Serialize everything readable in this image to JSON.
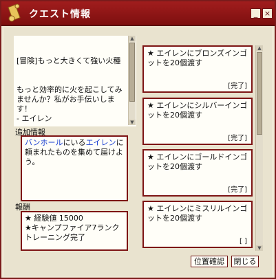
{
  "window": {
    "title": "クエスト情報",
    "minimize_glyph": "_",
    "close_glyph": "×"
  },
  "quest": {
    "title_text": "[冒険]もっと大きくて強い火種",
    "description": "もっと効率的に火を起こしてみませんか？私がお手伝いします！\n- エイレン"
  },
  "additional_info": {
    "label": "追加情報",
    "seg1": "バンホール",
    "seg2": "にいる",
    "seg3": "エイレン",
    "seg4": "に頼まれたものを集めて届けよう。"
  },
  "reward": {
    "label": "報酬",
    "line1": "★ 経験値 15000",
    "line2": "★キャンプファイア7ランクトレーニング完了"
  },
  "objectives": [
    {
      "text": "★ エイレンにブロンズインゴットを20個渡す",
      "status": "[完了]"
    },
    {
      "text": "★ エイレンにシルバーインゴットを20個渡す",
      "status": "[完了]"
    },
    {
      "text": "★ エイレンにゴールドインゴットを20個渡す",
      "status": "[完了]"
    },
    {
      "text": "★ エイレンにミスリルインゴットを20個渡す",
      "status": "[   ]"
    }
  ],
  "buttons": {
    "locate": "位置確認",
    "close": "閉じる"
  },
  "colors": {
    "title_bar": "#8f1616",
    "border": "#7d1414",
    "panel_bg": "#efe9d6",
    "link_blue": "#1a3fd1"
  },
  "icons": {
    "title_icon": "scroll-icon"
  }
}
